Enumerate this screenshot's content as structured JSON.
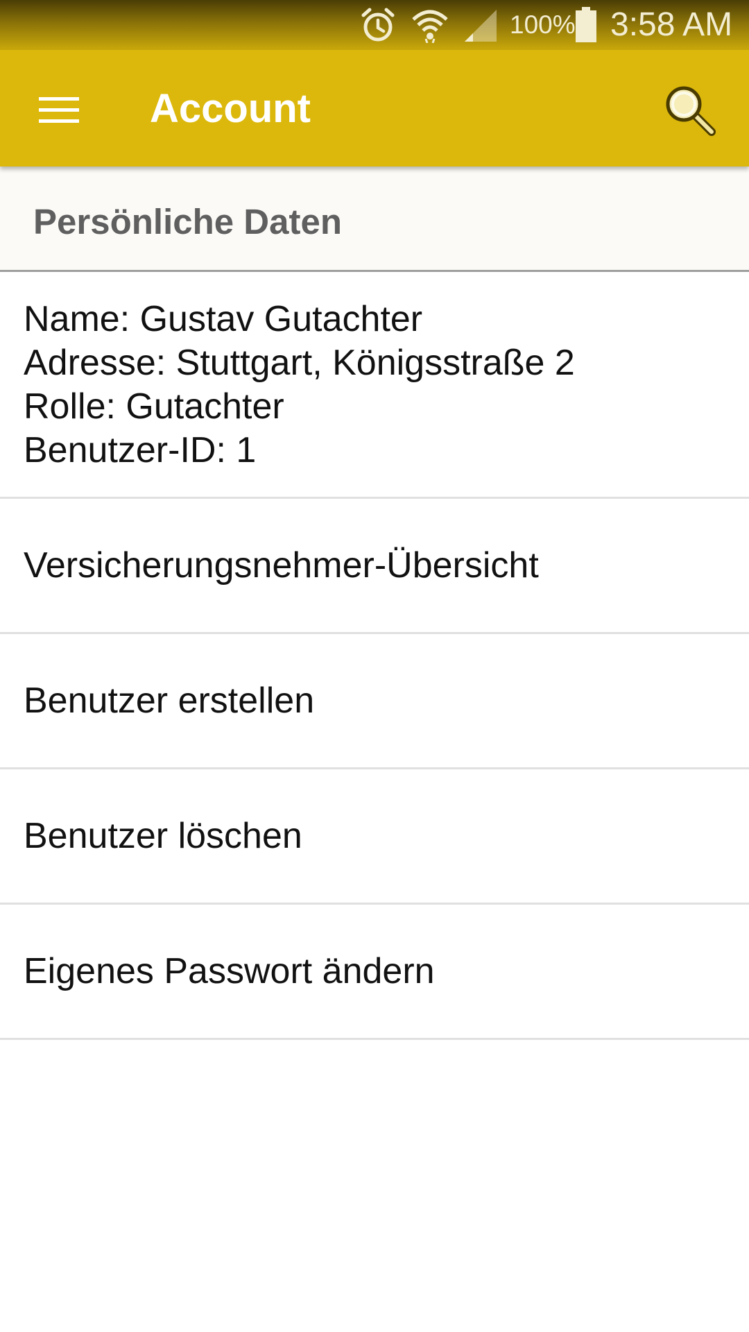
{
  "status_bar": {
    "battery_percent": "100%",
    "time": "3:58 AM",
    "icons": [
      "alarm-icon",
      "wifi-icon",
      "cell-signal-icon",
      "battery-icon"
    ]
  },
  "app_bar": {
    "title": "Account",
    "background": "#dcb80c",
    "icons": [
      "menu-icon",
      "search-icon"
    ]
  },
  "section": {
    "header": "Persönliche Daten"
  },
  "info": {
    "name": "Name: Gustav Gutachter",
    "address": "Adresse: Stuttgart, Königsstraße 2",
    "role": "Rolle: Gutachter",
    "user_id": "Benutzer-ID: 1"
  },
  "menu": {
    "items": [
      {
        "label": "Versicherungsnehmer-Übersicht"
      },
      {
        "label": "Benutzer erstellen"
      },
      {
        "label": "Benutzer löschen"
      },
      {
        "label": "Eigenes Passwort ändern"
      }
    ]
  }
}
